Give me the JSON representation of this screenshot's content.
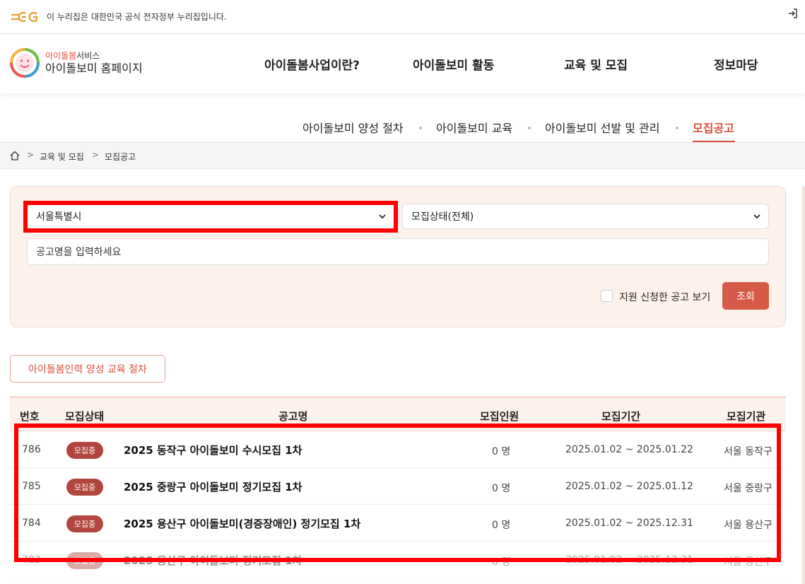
{
  "gov_banner": {
    "text": "이 누리집은 대한민국 공식 전자정부 누리집입니다.",
    "logo_icon": "egov-logo",
    "login_icon": "login-icon"
  },
  "brand": {
    "sub_accent": "아이돌봄",
    "sub_rest": "서비스",
    "title": "아이돌보미 홈페이지"
  },
  "gnb": [
    "아이돌봄사업이란?",
    "아이돌보미 활동",
    "교육 및 모집",
    "정보마당"
  ],
  "subnav": {
    "items": [
      "아이돌보미 양성 절차",
      "아이돌보미 교육",
      "아이돌보미 선발 및 관리",
      "모집공고"
    ],
    "active_index": 3
  },
  "breadcrumb": [
    "교육 및 모집",
    "모집공고"
  ],
  "search": {
    "region_value": "서울특별시",
    "status_value": "모집상태(전체)",
    "keyword_placeholder": "공고명을 입력하세요",
    "checkbox_label": "지원 신청한 공고 보기",
    "checkbox_checked": false,
    "submit_label": "조회"
  },
  "procedure_button": "아이돌봄인력 양성 교육 절차",
  "table": {
    "headers": [
      "번호",
      "모집상태",
      "공고명",
      "모집인원",
      "모집기간",
      "모집기관"
    ],
    "rows": [
      {
        "no": "786",
        "status": "모집중",
        "title": "2025 동작구 아이돌보미 수시모집 1차",
        "count": "0 명",
        "period": "2025.01.02 ~ 2025.01.22",
        "org": "서울 동작구"
      },
      {
        "no": "785",
        "status": "모집중",
        "title": "2025 중랑구 아이돌보미 정기모집 1차",
        "count": "0 명",
        "period": "2025.01.02 ~ 2025.01.12",
        "org": "서울 중랑구"
      },
      {
        "no": "784",
        "status": "모집중",
        "title": "2025 용산구 아이돌보미(경증장애인) 정기모집 1차",
        "count": "0 명",
        "period": "2025.01.02 ~ 2025.12.31",
        "org": "서울 용산구"
      },
      {
        "no": "783",
        "status": "모집중",
        "title": "2025 용산구 아이돌보미 정기모집 1차",
        "count": "0 명",
        "period": "2025.01.02 ~ 2025.12.31",
        "org": "서울 용산구"
      }
    ]
  },
  "colors": {
    "accent": "#d84f3d",
    "badge": "#b2463e",
    "highlight": "#ff0000",
    "panel_bg": "#fdf1ec"
  }
}
